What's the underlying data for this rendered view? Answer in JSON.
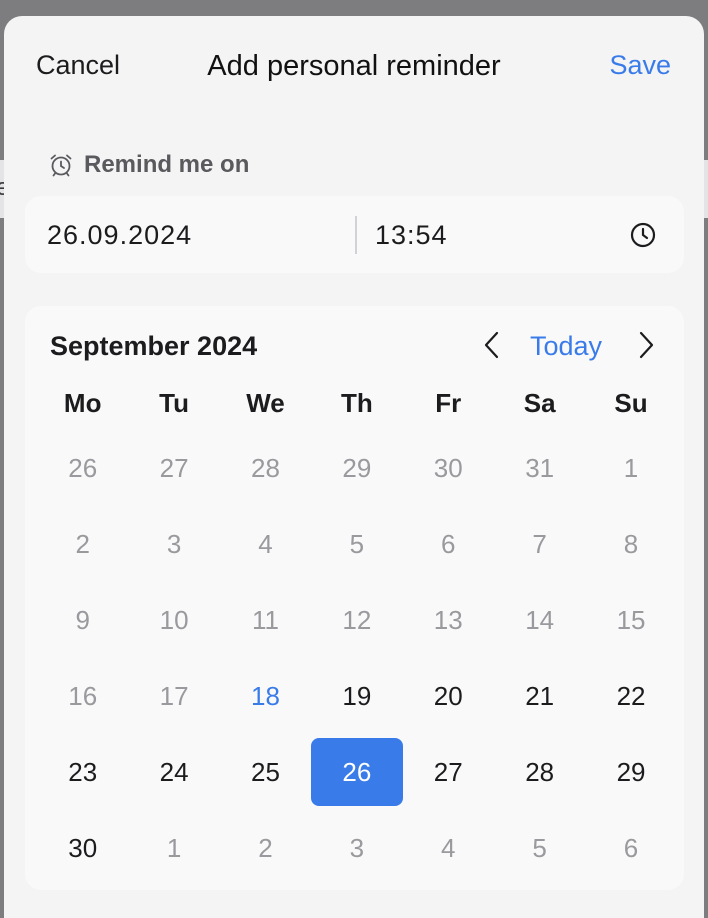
{
  "background": {
    "partial_glyph": "e"
  },
  "nav": {
    "cancel_label": "Cancel",
    "title": "Add personal reminder",
    "save_label": "Save"
  },
  "reminder": {
    "label": "Remind me on",
    "date": "26.09.2024",
    "time": "13:54"
  },
  "calendar": {
    "month_label": "September 2024",
    "today_label": "Today",
    "weekdays": [
      "Mo",
      "Tu",
      "We",
      "Th",
      "Fr",
      "Sa",
      "Su"
    ],
    "days": [
      {
        "label": "26",
        "state": "muted"
      },
      {
        "label": "27",
        "state": "muted"
      },
      {
        "label": "28",
        "state": "muted"
      },
      {
        "label": "29",
        "state": "muted"
      },
      {
        "label": "30",
        "state": "muted"
      },
      {
        "label": "31",
        "state": "muted"
      },
      {
        "label": "1",
        "state": "muted"
      },
      {
        "label": "2",
        "state": "muted"
      },
      {
        "label": "3",
        "state": "muted"
      },
      {
        "label": "4",
        "state": "muted"
      },
      {
        "label": "5",
        "state": "muted"
      },
      {
        "label": "6",
        "state": "muted"
      },
      {
        "label": "7",
        "state": "muted"
      },
      {
        "label": "8",
        "state": "muted"
      },
      {
        "label": "9",
        "state": "muted"
      },
      {
        "label": "10",
        "state": "muted"
      },
      {
        "label": "11",
        "state": "muted"
      },
      {
        "label": "12",
        "state": "muted"
      },
      {
        "label": "13",
        "state": "muted"
      },
      {
        "label": "14",
        "state": "muted"
      },
      {
        "label": "15",
        "state": "muted"
      },
      {
        "label": "16",
        "state": "muted"
      },
      {
        "label": "17",
        "state": "muted"
      },
      {
        "label": "18",
        "state": "today"
      },
      {
        "label": "19",
        "state": "normal"
      },
      {
        "label": "20",
        "state": "normal"
      },
      {
        "label": "21",
        "state": "normal"
      },
      {
        "label": "22",
        "state": "normal"
      },
      {
        "label": "23",
        "state": "normal"
      },
      {
        "label": "24",
        "state": "normal"
      },
      {
        "label": "25",
        "state": "normal"
      },
      {
        "label": "26",
        "state": "selected"
      },
      {
        "label": "27",
        "state": "normal"
      },
      {
        "label": "28",
        "state": "normal"
      },
      {
        "label": "29",
        "state": "normal"
      },
      {
        "label": "30",
        "state": "normal"
      },
      {
        "label": "1",
        "state": "muted"
      },
      {
        "label": "2",
        "state": "muted"
      },
      {
        "label": "3",
        "state": "muted"
      },
      {
        "label": "4",
        "state": "muted"
      },
      {
        "label": "5",
        "state": "muted"
      },
      {
        "label": "6",
        "state": "muted"
      }
    ]
  },
  "icons": {
    "alarm": "alarm-clock-icon",
    "clock": "clock-icon",
    "prev": "chevron-left-icon",
    "next": "chevron-right-icon"
  },
  "colors": {
    "accent": "#3a7bea",
    "text": "#1c1c1e",
    "muted": "#9a9a9e",
    "sheet_bg": "#f4f4f5",
    "card_bg": "#f9f9fa"
  }
}
